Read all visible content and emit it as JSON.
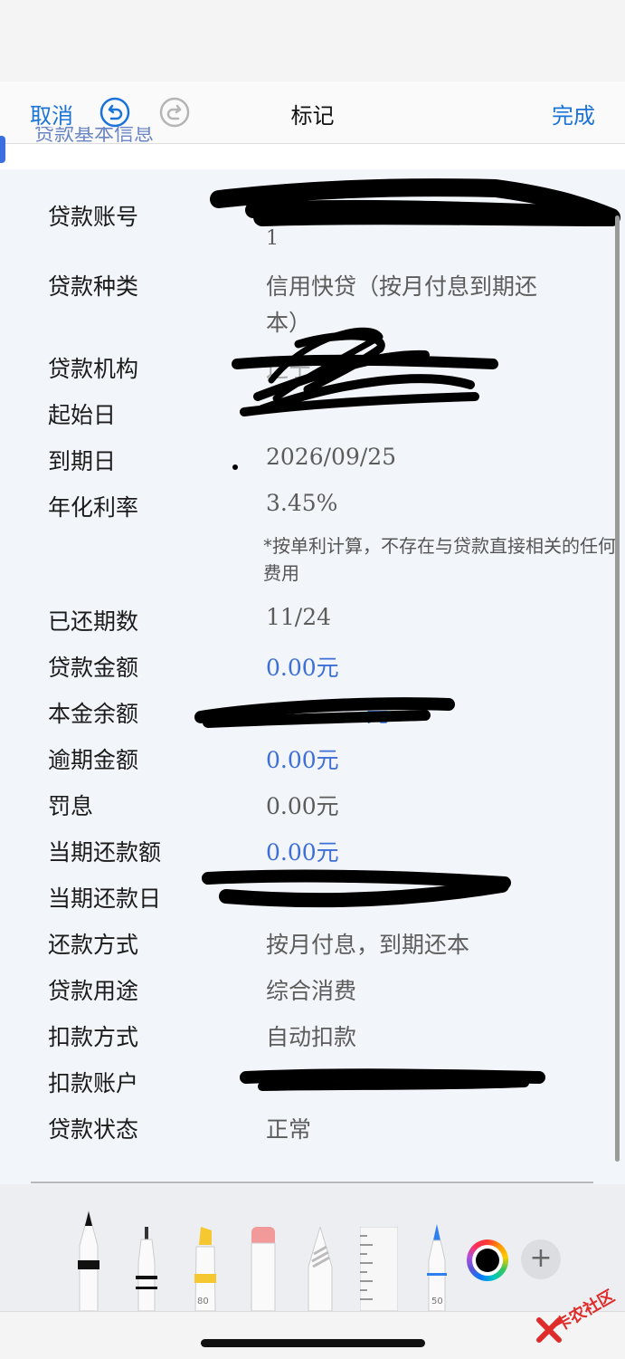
{
  "nav": {
    "cancel": "取消",
    "title": "标记",
    "done": "完成"
  },
  "strip_text": "贷款基本信息",
  "rows": [
    {
      "label": "贷款账号",
      "value": "1"
    },
    {
      "label": "贷款种类",
      "value_line1": "信用快贷（按月付息到期还",
      "value_line2": "本）"
    },
    {
      "label": "贷款机构",
      "value": "辽宁"
    },
    {
      "label": "起始日",
      "value": ""
    },
    {
      "label": "到期日",
      "value": "2026/09/25"
    },
    {
      "label": "年化利率",
      "value": "3.45%"
    },
    {
      "label": "已还期数",
      "value": "11/24"
    },
    {
      "label": "贷款金额",
      "value": "0.00元"
    },
    {
      "label": "本金余额",
      "value": "元"
    },
    {
      "label": "逾期金额",
      "value": "0.00元"
    },
    {
      "label": "罚息",
      "value": "0.00元"
    },
    {
      "label": "当期还款额",
      "value": "0.00元"
    },
    {
      "label": "当期还款日",
      "value": ""
    },
    {
      "label": "还款方式",
      "value": "按月付息，到期还本"
    },
    {
      "label": "贷款用途",
      "value": "综合消费"
    },
    {
      "label": "扣款方式",
      "value": "自动扣款"
    },
    {
      "label": "扣款账户",
      "value": ""
    },
    {
      "label": "贷款状态",
      "value": "正常"
    }
  ],
  "note": "*按单利计算，不存在与贷款直接相关的任何费用",
  "tools": {
    "highlighter_label": "80",
    "pen_label": "50",
    "plus": "+"
  },
  "colors": {
    "accent": "#1a73d9",
    "value_blue": "#3d6fd6",
    "selected_color": "#000000"
  },
  "watermark": "卡农社区"
}
